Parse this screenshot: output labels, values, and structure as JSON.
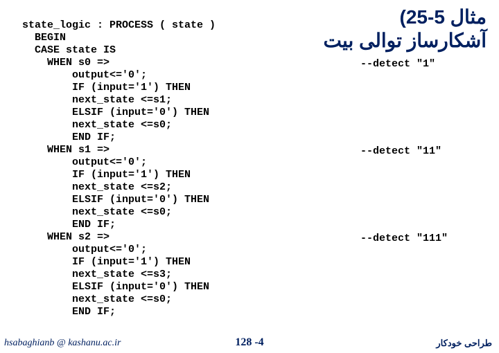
{
  "title": {
    "line1": "مثال 5-25)",
    "line2": "آشکارساز توالی بیت"
  },
  "code": "state_logic : PROCESS ( state )\n  BEGIN\n  CASE state IS\n    WHEN s0 =>\n        output<='0';\n        IF (input='1') THEN\n        next_state <=s1;\n        ELSIF (input='0') THEN\n        next_state <=s0;\n        END IF;\n    WHEN s1 =>\n        output<='0';\n        IF (input='1') THEN\n        next_state <=s2;\n        ELSIF (input='0') THEN\n        next_state <=s0;\n        END IF;\n    WHEN s2 =>\n        output<='0';\n        IF (input='1') THEN\n        next_state <=s3;\n        ELSIF (input='0') THEN\n        next_state <=s0;\n        END IF;",
  "comments": {
    "c1": "--detect \"1\"",
    "c2": "--detect \"11\"",
    "c3": "--detect \"111\""
  },
  "footer": {
    "left": "hsabaghianb @ kashanu.ac.ir",
    "center": "128 -4",
    "right": "طراحی خودکار"
  }
}
